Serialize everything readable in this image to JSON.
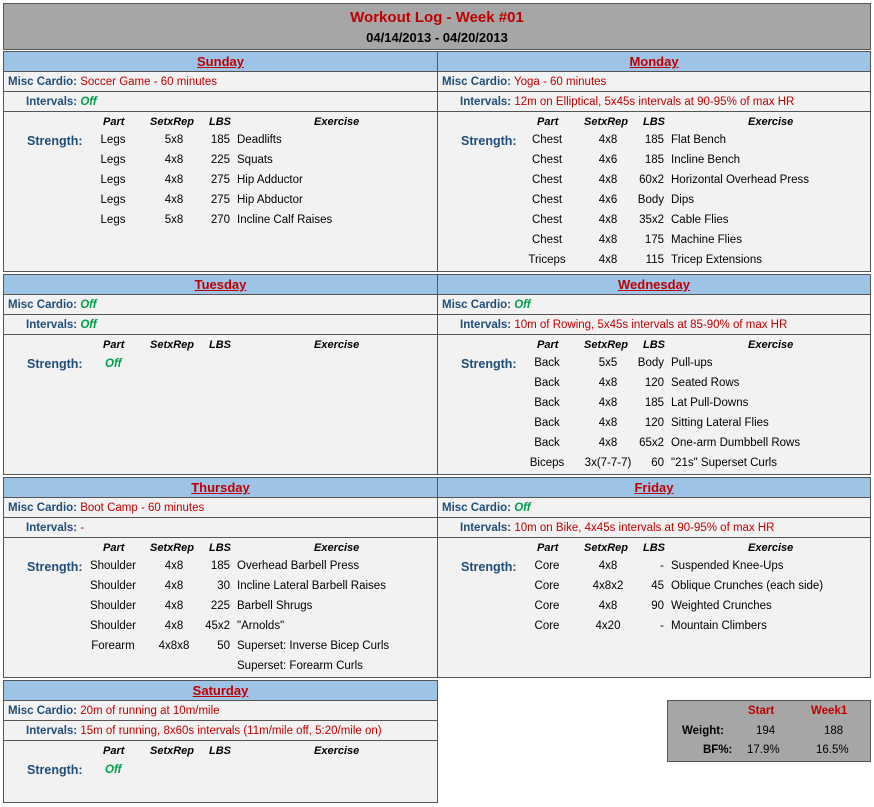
{
  "title": "Workout Log - Week #01",
  "date_range": "04/14/2013 - 04/20/2013",
  "labels": {
    "misc_cardio": "Misc Cardio:",
    "intervals": "Intervals:",
    "strength": "Strength:",
    "col_part": "Part",
    "col_setxrep": "SetxRep",
    "col_lbs": "LBS",
    "col_exercise": "Exercise"
  },
  "days": [
    {
      "name": "Sunday",
      "cardio": "Soccer Game - 60 minutes",
      "cardio_off": false,
      "intervals": "Off",
      "intervals_off": true,
      "strength_off": "",
      "exercises": [
        [
          "Legs",
          "5x8",
          "185",
          "Deadlifts"
        ],
        [
          "Legs",
          "4x8",
          "225",
          "Squats"
        ],
        [
          "Legs",
          "4x8",
          "275",
          "Hip Adductor"
        ],
        [
          "Legs",
          "4x8",
          "275",
          "Hip Abductor"
        ],
        [
          "Legs",
          "5x8",
          "270",
          "Incline Calf Raises"
        ]
      ]
    },
    {
      "name": "Monday",
      "cardio": "Yoga - 60 minutes",
      "cardio_off": false,
      "intervals": "12m on Elliptical, 5x45s intervals at 90-95% of max HR",
      "intervals_off": false,
      "strength_off": "",
      "exercises": [
        [
          "Chest",
          "4x8",
          "185",
          "Flat Bench"
        ],
        [
          "Chest",
          "4x6",
          "185",
          "Incline Bench"
        ],
        [
          "Chest",
          "4x8",
          "60x2",
          "Horizontal Overhead Press"
        ],
        [
          "Chest",
          "4x6",
          "Body",
          "Dips"
        ],
        [
          "Chest",
          "4x8",
          "35x2",
          "Cable Flies"
        ],
        [
          "Chest",
          "4x8",
          "175",
          "Machine Flies"
        ],
        [
          "Triceps",
          "4x8",
          "115",
          "Tricep Extensions"
        ]
      ]
    },
    {
      "name": "Tuesday",
      "cardio": "Off",
      "cardio_off": true,
      "intervals": "Off",
      "intervals_off": true,
      "strength_off": "Off",
      "exercises": []
    },
    {
      "name": "Wednesday",
      "cardio": "Off",
      "cardio_off": true,
      "intervals": "10m of Rowing, 5x45s intervals at 85-90% of max HR",
      "intervals_off": false,
      "strength_off": "",
      "exercises": [
        [
          "Back",
          "5x5",
          "Body",
          "Pull-ups"
        ],
        [
          "Back",
          "4x8",
          "120",
          "Seated Rows"
        ],
        [
          "Back",
          "4x8",
          "185",
          "Lat Pull-Downs"
        ],
        [
          "Back",
          "4x8",
          "120",
          "Sitting Lateral Flies"
        ],
        [
          "Back",
          "4x8",
          "65x2",
          "One-arm Dumbbell Rows"
        ],
        [
          "Biceps",
          "3x(7-7-7)",
          "60",
          "\"21s\" Superset Curls"
        ]
      ]
    },
    {
      "name": "Thursday",
      "cardio": "Boot Camp - 60 minutes",
      "cardio_off": false,
      "intervals": "-",
      "intervals_off": false,
      "strength_off": "",
      "exercises": [
        [
          "Shoulder",
          "4x8",
          "185",
          "Overhead Barbell Press"
        ],
        [
          "Shoulder",
          "4x8",
          "30",
          "Incline Lateral Barbell Raises"
        ],
        [
          "Shoulder",
          "4x8",
          "225",
          "Barbell Shrugs"
        ],
        [
          "Shoulder",
          "4x8",
          "45x2",
          "\"Arnolds\""
        ],
        [
          "Forearm",
          "4x8x8",
          "50",
          "Superset: Inverse Bicep Curls"
        ],
        [
          "",
          "",
          "",
          "Superset: Forearm Curls"
        ]
      ]
    },
    {
      "name": "Friday",
      "cardio": "Off",
      "cardio_off": true,
      "intervals": "10m on Bike, 4x45s intervals at 90-95% of max HR",
      "intervals_off": false,
      "strength_off": "",
      "exercises": [
        [
          "Core",
          "4x8",
          "-",
          "Suspended Knee-Ups"
        ],
        [
          "Core",
          "4x8x2",
          "45",
          "Oblique Crunches (each side)"
        ],
        [
          "Core",
          "4x8",
          "90",
          "Weighted Crunches"
        ],
        [
          "Core",
          "4x20",
          "-",
          "Mountain Climbers"
        ]
      ]
    },
    {
      "name": "Saturday",
      "cardio": "20m of running at 10m/mile",
      "cardio_off": false,
      "intervals": "15m of running, 8x60s intervals (11m/mile off, 5:20/mile on)",
      "intervals_off": false,
      "strength_off": "Off",
      "exercises": []
    }
  ],
  "stats": {
    "col_start": "Start",
    "col_week1": "Week1",
    "weight_label": "Weight:",
    "weight_start": "194",
    "weight_week1": "188",
    "bf_label": "BF%:",
    "bf_start": "17.9%",
    "bf_week1": "16.5%"
  }
}
